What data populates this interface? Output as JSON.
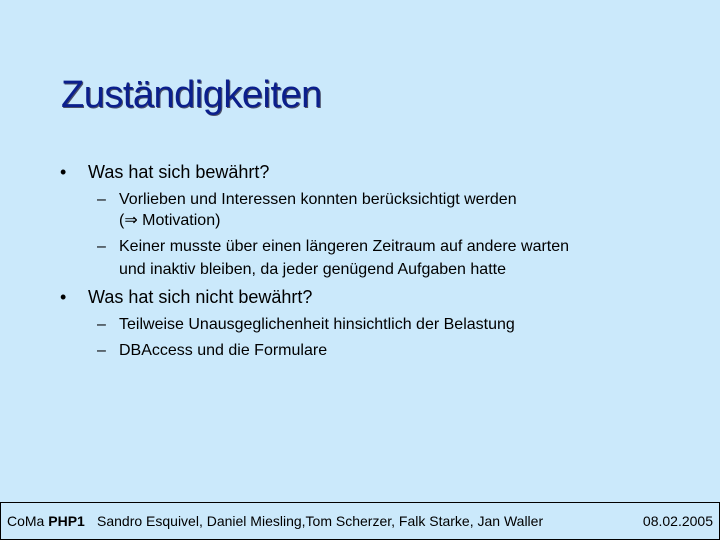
{
  "slide": {
    "title": "Zuständigkeiten",
    "bullet_marker": "•",
    "sub_marker": "–",
    "sections": [
      {
        "heading": "Was hat sich bewährt?",
        "items": [
          {
            "line1": "Vorlieben und Interessen konnten berücksichtigt werden",
            "line2": "(⇒ Motivation)"
          },
          {
            "line1": "Keiner musste über einen längeren Zeitraum auf andere warten",
            "line2": "und inaktiv bleiben, da jeder genügend Aufgaben hatte"
          }
        ]
      },
      {
        "heading": "Was hat sich nicht bewährt?",
        "items": [
          {
            "line1": "Teilweise Unausgeglichenheit hinsichtlich der Belastung"
          },
          {
            "line1": "DBAccess und die Formulare"
          }
        ]
      }
    ]
  },
  "footer": {
    "course_prefix": "CoMa",
    "course_bold": "PHP1",
    "authors": "Sandro Esquivel, Daniel Miesling,Tom Scherzer, Falk Starke, Jan Waller",
    "date": "08.02.2005"
  },
  "colors": {
    "background": "#cbe9fb",
    "title": "#0b1f8c"
  }
}
